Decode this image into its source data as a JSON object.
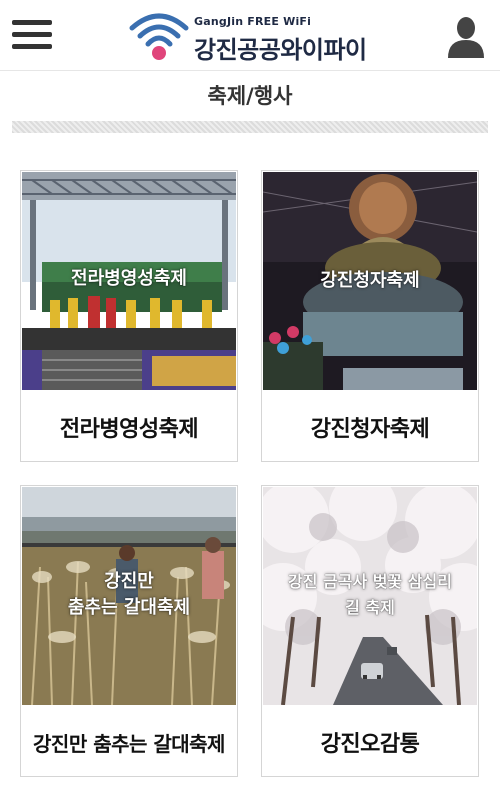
{
  "header": {
    "logo_small": "GangJin FREE WiFi",
    "logo_main": "강진공공와이파이",
    "menu_icon": "hamburger-menu-icon",
    "user_icon": "user-silhouette-icon",
    "wifi_icon": "wifi-logo-icon"
  },
  "section": {
    "title": "축제/행사"
  },
  "cards": [
    {
      "overlay": "전라병영성축제",
      "title": "전라병영성축제"
    },
    {
      "overlay": "강진청자축제",
      "title": "강진청자축제"
    },
    {
      "overlay_lines": [
        "강진만",
        "춤추는 갈대축제"
      ],
      "title": "강진만 춤추는 갈대축제"
    },
    {
      "overlay_lines": [
        "강진 금곡사 벚꽃 삼십리",
        "길 축제"
      ],
      "title": "강진오감통"
    }
  ],
  "colors": {
    "wifi_blue": "#3a6fb0",
    "wifi_pink": "#e0457b",
    "logo_text": "#1f2a44"
  }
}
